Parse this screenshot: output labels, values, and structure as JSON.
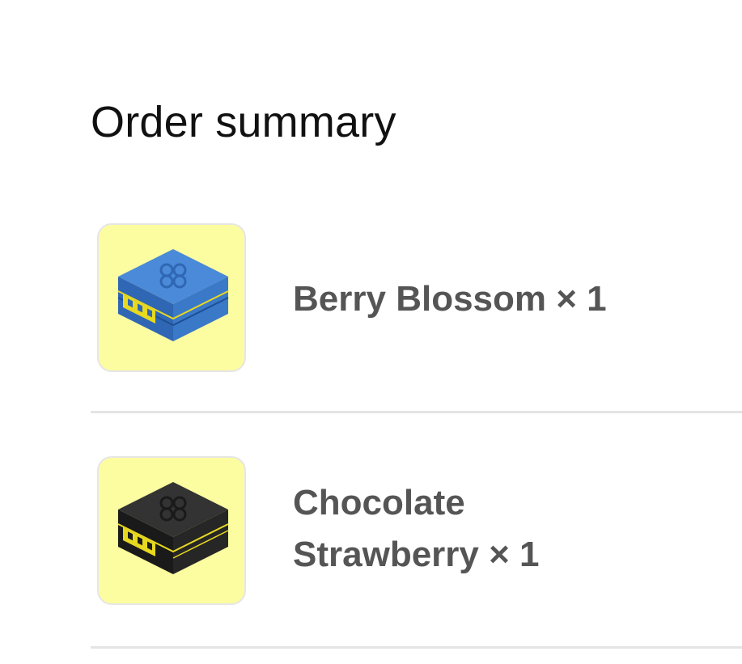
{
  "summary": {
    "title": "Order summary"
  },
  "items": [
    {
      "name_line1": "Berry Blossom × 1",
      "name_line2": "",
      "box_color": "#3a78c8",
      "box_dark": "#2b5da3",
      "icon": "blue-gift-box-icon"
    },
    {
      "name_line1": "Chocolate",
      "name_line2": "Strawberry × 1",
      "box_color": "#2a2a2a",
      "box_dark": "#161616",
      "icon": "black-gift-box-icon"
    }
  ],
  "colors": {
    "thumb_bg": "#fcfca0",
    "accent": "#e8d820",
    "text": "#555555"
  }
}
